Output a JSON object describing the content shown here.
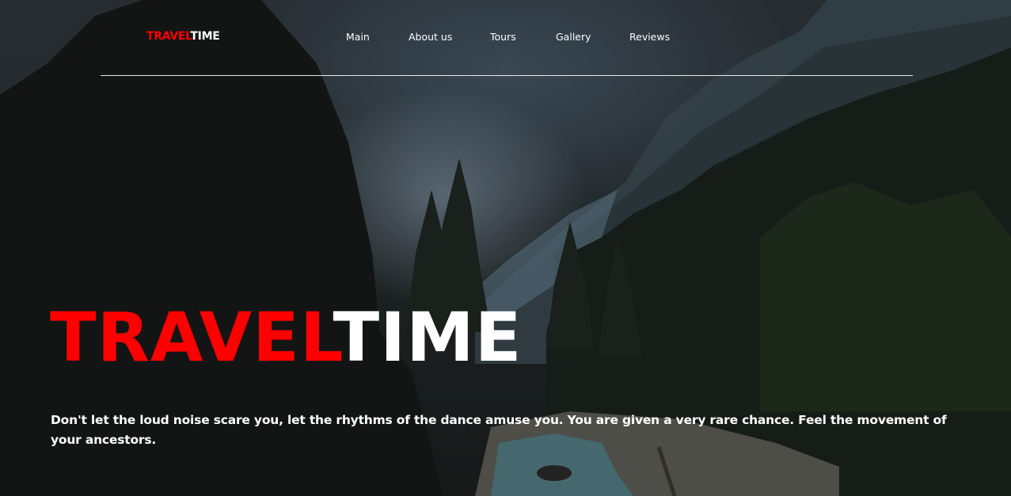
{
  "header": {
    "logo": {
      "part1": "TRAVEL",
      "part2": "TIME"
    },
    "nav": {
      "main": "Main",
      "about": "About us",
      "tours": "Tours",
      "gallery": "Gallery",
      "reviews": "Reviews"
    }
  },
  "hero": {
    "title": {
      "part1": "TRAVEL",
      "part2": "TIME"
    },
    "description": "Don't let the loud noise scare you, let the rhythms of the dance amuse you. You are given a very rare chance. Feel the movement of your ancestors."
  },
  "colors": {
    "accent": "#ff0000",
    "text": "#ffffff",
    "background": "#1c1d1e"
  }
}
